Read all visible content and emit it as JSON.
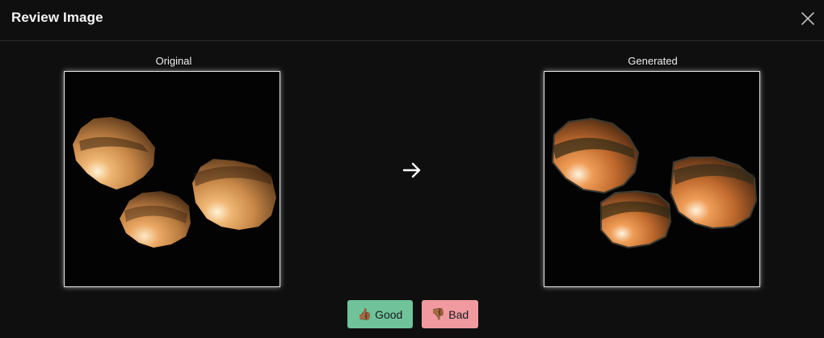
{
  "dialog": {
    "title": "Review Image",
    "close_icon": "close-icon"
  },
  "panels": {
    "original_label": "Original",
    "generated_label": "Generated"
  },
  "arrow_icon": "arrow-right-icon",
  "actions": {
    "good_emoji": "👍🏾",
    "good_label": "Good",
    "bad_emoji": "👎🏾",
    "bad_label": "Bad"
  },
  "colors": {
    "background": "#0f0f0f",
    "good": "#6fc29a",
    "bad": "#f09aa0",
    "frame_border": "#e8e8e8"
  }
}
